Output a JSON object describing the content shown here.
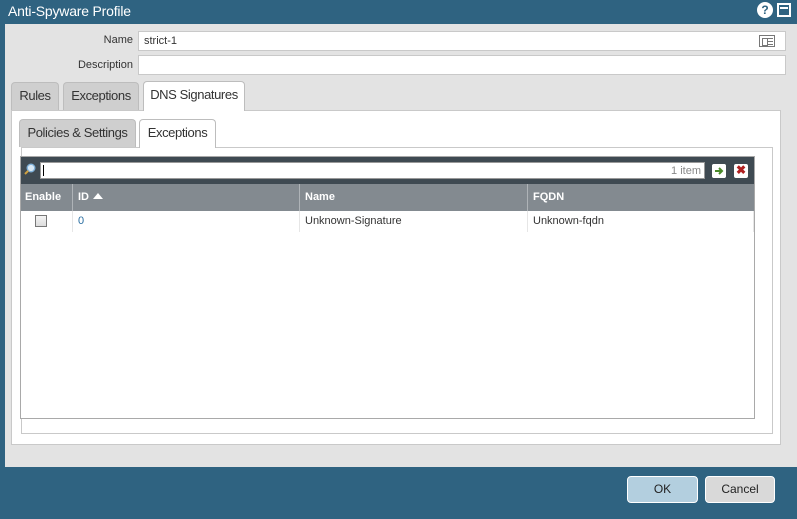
{
  "window": {
    "title": "Anti-Spyware Profile"
  },
  "form": {
    "name_label": "Name",
    "name_value": "strict-1",
    "description_label": "Description",
    "description_value": ""
  },
  "tabs": [
    {
      "label": "Rules",
      "active": false
    },
    {
      "label": "Exceptions",
      "active": false
    },
    {
      "label": "DNS Signatures",
      "active": true
    }
  ],
  "subtabs": [
    {
      "label": "Policies & Settings",
      "active": false
    },
    {
      "label": "Exceptions",
      "active": true
    }
  ],
  "grid": {
    "search_value": "",
    "count_text": "1 item",
    "columns": [
      "Enable",
      "ID",
      "Name",
      "FQDN"
    ],
    "sorted_column": "ID",
    "sort_direction": "ascending",
    "rows": [
      {
        "enabled": false,
        "id": "0",
        "name": "Unknown-Signature",
        "fqdn": "Unknown-fqdn"
      }
    ]
  },
  "footer": {
    "ok_label": "OK",
    "cancel_label": "Cancel"
  },
  "icons": [
    "help-icon",
    "maximize-icon",
    "name-options-icon",
    "search-icon",
    "go-arrow-icon",
    "clear-filter-icon",
    "sort-ascending-icon"
  ],
  "colors": {
    "chrome": "#2f6381",
    "dialog_bg": "#e3e3e3",
    "grid_toolbar": "#3f4a52",
    "grid_header": "#838a90",
    "link": "#2a6ea1"
  }
}
